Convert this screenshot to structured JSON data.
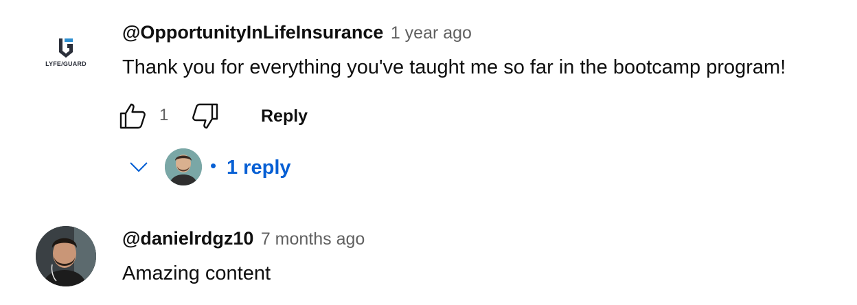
{
  "comments": [
    {
      "author": "@OpportunityInLifeInsurance",
      "timestamp": "1 year ago",
      "text": "Thank you for everything you've taught me so far in the bootcamp program!",
      "avatar_text": "LYFE/GUARD",
      "like_count": "1",
      "reply_label": "Reply",
      "replies_label": "1 reply",
      "replies_separator": "•"
    },
    {
      "author": "@danielrdgz10",
      "timestamp": "7 months ago",
      "text": "Amazing content"
    }
  ],
  "icons": {
    "like": "thumbs-up-icon",
    "dislike": "thumbs-down-icon",
    "expand": "chevron-down-icon"
  },
  "colors": {
    "link_blue": "#065fd4",
    "secondary_text": "#606060",
    "primary_text": "#0f0f0f"
  }
}
